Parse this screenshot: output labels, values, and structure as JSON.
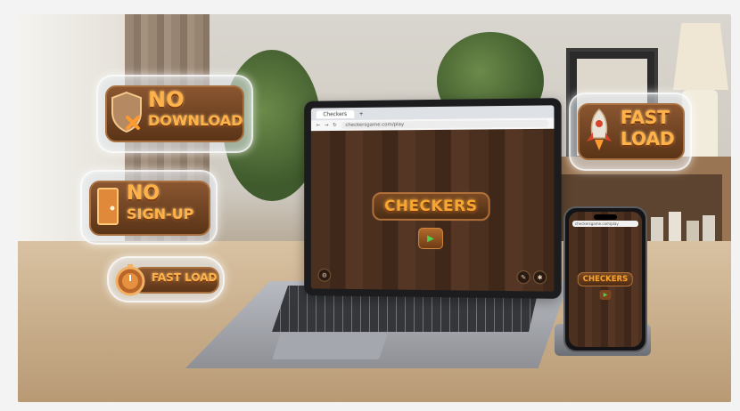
{
  "badges": {
    "no_download": {
      "line1": "NO",
      "line2": "DOWNLOAD",
      "icon": "shield-x-icon"
    },
    "no_signup": {
      "line1": "NO",
      "line2": "SIGN-UP",
      "icon": "door-icon"
    },
    "fast_load_small": {
      "label": "FAST LOAD",
      "icon": "stopwatch-icon"
    },
    "fast_load_large": {
      "line1": "FAST",
      "line2": "LOAD",
      "icon": "rocket-icon"
    }
  },
  "laptop": {
    "tab_title": "Checkers",
    "url": "checkersgame.com/play",
    "game_title": "CHECKERS",
    "play_icon": "play-icon"
  },
  "phone": {
    "url": "checkersgame.com/play",
    "game_title": "CHECKERS"
  },
  "colors": {
    "accent": "#f7a631",
    "wood": "#4b3020",
    "play": "#4fd150"
  }
}
